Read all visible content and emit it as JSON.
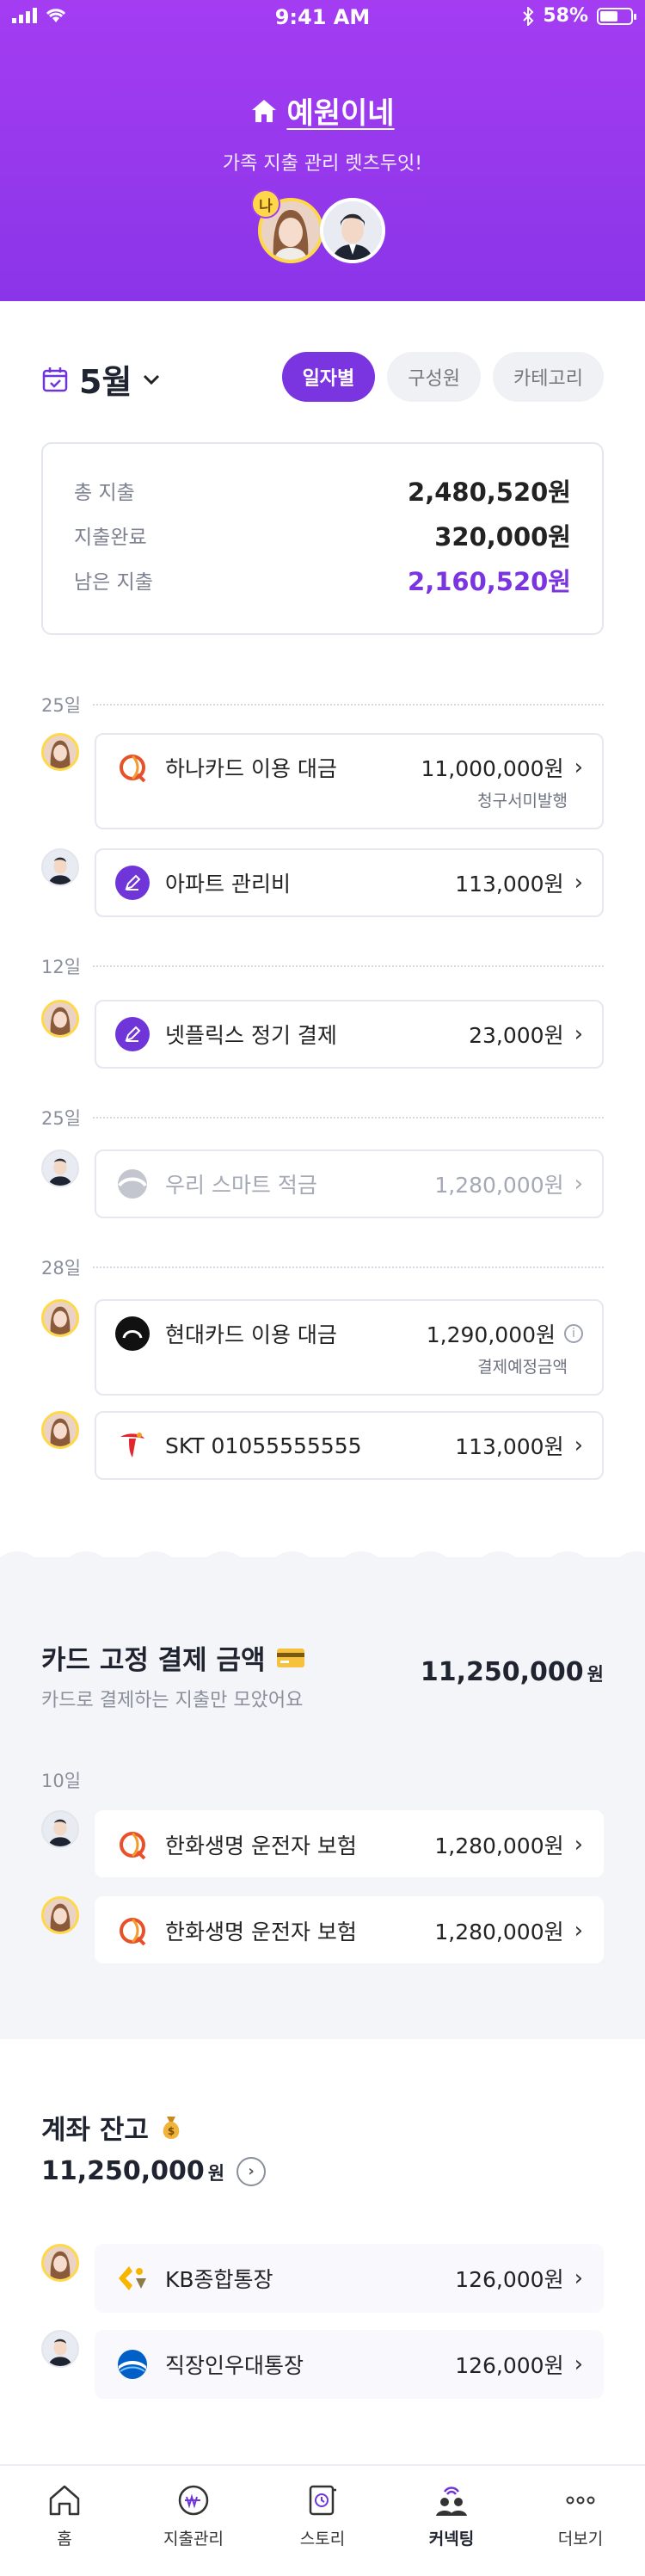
{
  "status_bar": {
    "time": "9:41 AM",
    "battery": "58%",
    "battery_level": 0.58
  },
  "header": {
    "family_name": "예원이네",
    "subtitle": "가족 지출 관리 렛츠두잇!",
    "me_badge": "나"
  },
  "filter": {
    "month": "5월",
    "chips": [
      {
        "label": "일자별",
        "active": true
      },
      {
        "label": "구성원",
        "active": false
      },
      {
        "label": "카테고리",
        "active": false
      }
    ]
  },
  "summary": [
    {
      "label": "총 지출",
      "value": "2,480,520원"
    },
    {
      "label": "지출완료",
      "value": "320,000원"
    },
    {
      "label": "남은 지출",
      "value": "2,160,520원"
    }
  ],
  "expenses": {
    "days": [
      "25일",
      "12일",
      "25일",
      "28일"
    ],
    "items": [
      {
        "title": "하나카드 이용 대금",
        "amount": "11,000,000원",
        "sub": "청구서미발행",
        "member": "me",
        "logo": "hana-logo",
        "logo_color": "#e8502a"
      },
      {
        "title": "아파트 관리비",
        "amount": "113,000원",
        "sub": "",
        "member": "other",
        "logo": "pencil-icon",
        "logo_color": "#6f35d9"
      },
      {
        "title": "넷플릭스 정기 결제",
        "amount": "23,000원",
        "sub": "",
        "member": "me",
        "logo": "pencil-icon",
        "logo_color": "#6f35d9"
      },
      {
        "title": "우리 스마트 적금",
        "amount": "1,280,000원",
        "sub": "",
        "member": "other",
        "logo": "woori-logo",
        "logo_color": "#b5b8c2"
      },
      {
        "title": "현대카드 이용 대금",
        "amount": "1,290,000원",
        "sub": "결제예정금액",
        "member": "me",
        "logo": "hyundai-card-logo",
        "logo_color": "#111111"
      },
      {
        "title": "SKT 01055555555",
        "amount": "113,000원",
        "sub": "",
        "member": "me",
        "logo": "skt-logo",
        "logo_color": "#e1262d"
      }
    ]
  },
  "card_fixed": {
    "title": "카드 고정 결제 금액",
    "subtitle": "카드로 결제하는 지출만 모았어요",
    "amount": "11,250,000",
    "won": "원",
    "day": "10일",
    "items": [
      {
        "title": "한화생명 운전자 보험",
        "amount": "1,280,000원",
        "member": "other"
      },
      {
        "title": "한화생명 운전자 보험",
        "amount": "1,280,000원",
        "member": "me"
      }
    ]
  },
  "account_balance": {
    "title": "계좌 잔고",
    "amount": "11,250,000",
    "won": "원",
    "items": [
      {
        "title": "KB종합통장",
        "amount": "126,000원",
        "member": "me"
      },
      {
        "title": "직장인우대통장",
        "amount": "126,000원",
        "member": "other"
      }
    ]
  },
  "bottom_nav": [
    {
      "label": "홈",
      "icon": "home-icon"
    },
    {
      "label": "지출관리",
      "icon": "won-coin-icon"
    },
    {
      "label": "스토리",
      "icon": "story-icon"
    },
    {
      "label": "커넥팅",
      "icon": "connecting-icon",
      "active": true
    },
    {
      "label": "더보기",
      "icon": "more-icon"
    }
  ],
  "colors": {
    "brand": "#8b35e8",
    "accent": "#7a34e0",
    "me_ring": "#ffd84a"
  }
}
